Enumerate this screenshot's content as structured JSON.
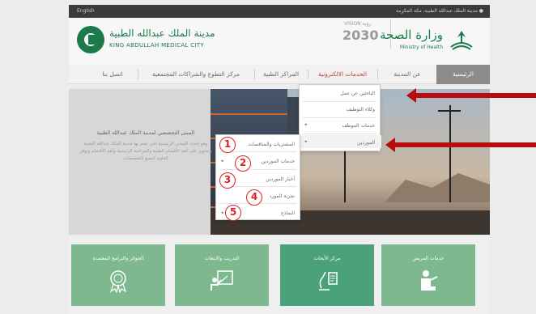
{
  "topbar": {
    "language": "English",
    "location": "مدينة الملك عبدالله الطبية، مكة المكرمة"
  },
  "header": {
    "kamc_ar": "مدينة الملك عبدالله الطبية",
    "kamc_en": "KING ABDULLAH MEDICAL CITY",
    "moh_ar": "وزارة الصحة",
    "moh_en": "Ministry of Health",
    "vision_top": "VISION رؤية",
    "vision_year": "2030"
  },
  "nav": {
    "items": [
      {
        "label": "الرئيسية"
      },
      {
        "label": "عن المدينة"
      },
      {
        "label": "الخدمات الالكترونية"
      },
      {
        "label": "المراكز الطبية"
      },
      {
        "label": "مركز التطوع والشراكات المجتمعية"
      },
      {
        "label": "اتصل بنا"
      }
    ]
  },
  "menu": {
    "items": [
      {
        "label": "الباحثين عن عمل"
      },
      {
        "label": "وكلاء التوظيف"
      },
      {
        "label": "خدمات الموظف"
      },
      {
        "label": "الموردين"
      }
    ],
    "arrow": "◂"
  },
  "submenu": {
    "items": [
      {
        "label": "المشتريات والمناقصات",
        "number": "1"
      },
      {
        "label": "خدمات الموردين",
        "number": "2"
      },
      {
        "label": "أخبار الموردين",
        "number": "3"
      },
      {
        "label": "تجربة المورد",
        "number": "4"
      },
      {
        "label": "النماذج",
        "number": "5"
      }
    ],
    "arrow": "◂"
  },
  "hero": {
    "title": "المبنى التخصصي لمدينة الملك عبدالله الطبية",
    "body": "وهو إحدى المباني الرئيسية التي تضم بها مدينة الملك عبدالله الطبية وتحتوي على أهم الأقسام الطبية والجراحية الرئيسية وأهم الأقسام وتوفر العلوم لجميع التخصصات"
  },
  "tiles": [
    {
      "label": "خدمات المريض",
      "icon": "patient-care-icon"
    },
    {
      "label": "مركز الأبحاث",
      "icon": "research-microscope-icon"
    },
    {
      "label": "التدريب والابتعاث",
      "icon": "training-board-icon"
    },
    {
      "label": "الجوائز والبرامج المعتمدة",
      "icon": "award-medal-icon"
    }
  ],
  "colors": {
    "accent_green": "#1a7a4a",
    "tile_light": "#7eb88e",
    "tile_dark": "#4ba17a",
    "annotation_red": "#b80d0d"
  }
}
